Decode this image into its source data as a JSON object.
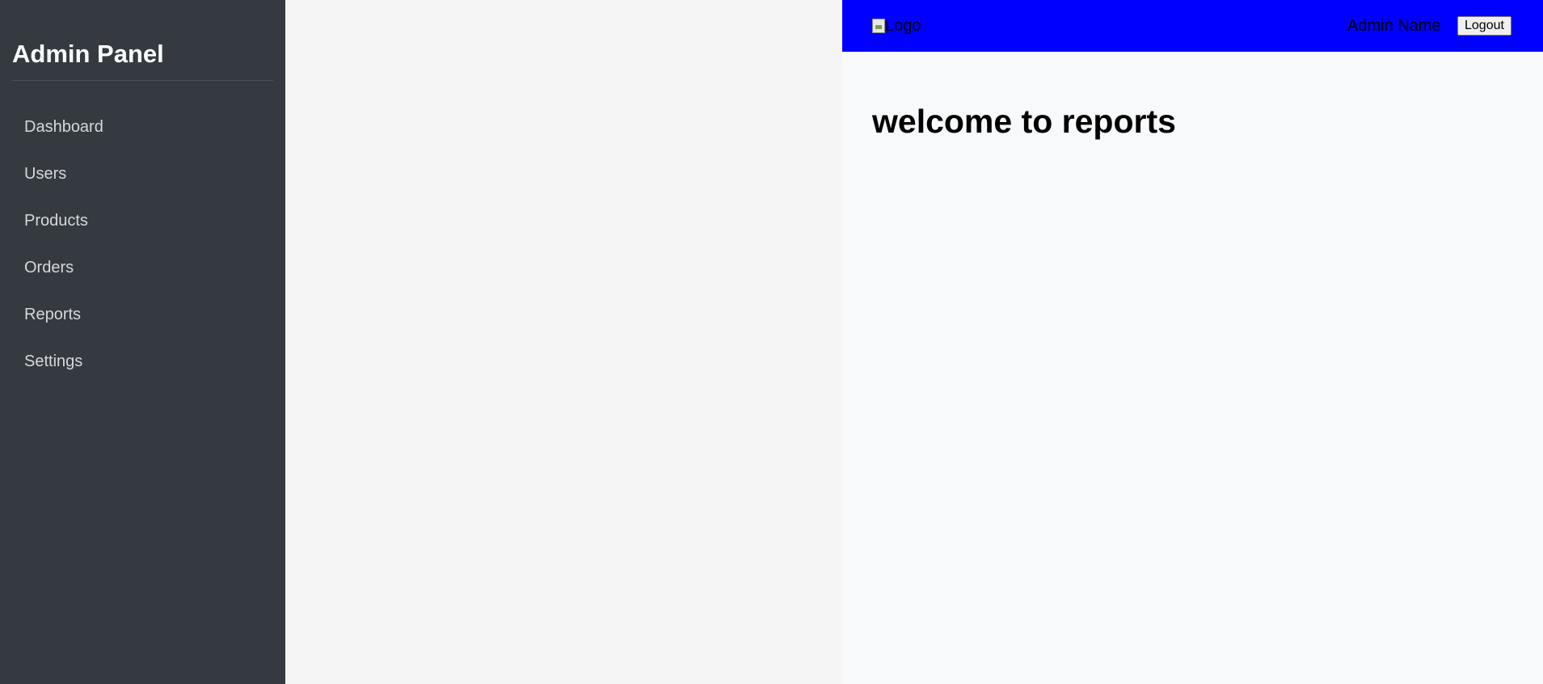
{
  "sidebar": {
    "title": "Admin Panel",
    "items": [
      {
        "label": "Dashboard"
      },
      {
        "label": "Users"
      },
      {
        "label": "Products"
      },
      {
        "label": "Orders"
      },
      {
        "label": "Reports"
      },
      {
        "label": "Settings"
      }
    ]
  },
  "header": {
    "logo_alt": "Logo",
    "admin_name": "Admin Name",
    "logout_label": "Logout",
    "background_color": "#0000ff"
  },
  "main": {
    "heading": "welcome to reports"
  },
  "colors": {
    "sidebar_bg": "#343a40",
    "main_bg": "#f8f9fa",
    "gap_bg": "#f5f5f5"
  }
}
